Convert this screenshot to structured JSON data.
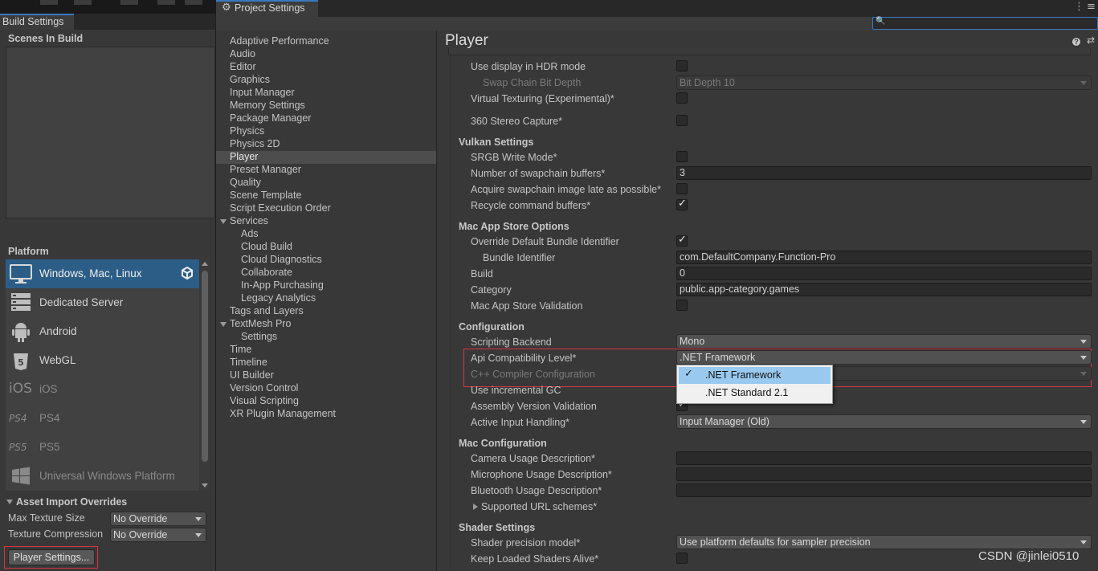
{
  "build_settings": {
    "tab_title": "Build Settings",
    "scenes_header": "Scenes In Build",
    "platform_header": "Platform",
    "platforms": [
      {
        "label": "Windows, Mac, Linux",
        "icon": "monitor-icon",
        "selected": true
      },
      {
        "label": "Dedicated Server",
        "icon": "server-icon"
      },
      {
        "label": "Android",
        "icon": "android-icon"
      },
      {
        "label": "WebGL",
        "icon": "html5-icon",
        "icon_text": "HTML 5"
      },
      {
        "label": "iOS",
        "icon": "ios-icon",
        "icon_text": "iOS",
        "disabled": true
      },
      {
        "label": "PS4",
        "icon": "ps4-icon",
        "icon_text": "PS4",
        "disabled": true
      },
      {
        "label": "PS5",
        "icon": "ps5-icon",
        "icon_text": "PS5",
        "disabled": true
      },
      {
        "label": "Universal Windows Platform",
        "icon": "windows-icon",
        "disabled": true
      }
    ],
    "asset_import_header": "Asset Import Overrides",
    "max_texture_label": "Max Texture Size",
    "max_texture_value": "No Override",
    "texture_compression_label": "Texture Compression",
    "texture_compression_value": "No Override",
    "player_settings_button": "Player Settings..."
  },
  "project_settings": {
    "tab_title": "Project Settings",
    "categories": [
      {
        "label": "Adaptive Performance"
      },
      {
        "label": "Audio"
      },
      {
        "label": "Editor"
      },
      {
        "label": "Graphics"
      },
      {
        "label": "Input Manager"
      },
      {
        "label": "Memory Settings"
      },
      {
        "label": "Package Manager"
      },
      {
        "label": "Physics"
      },
      {
        "label": "Physics 2D"
      },
      {
        "label": "Player",
        "selected": true
      },
      {
        "label": "Preset Manager"
      },
      {
        "label": "Quality"
      },
      {
        "label": "Scene Template"
      },
      {
        "label": "Script Execution Order"
      },
      {
        "label": "Services",
        "foldout": true
      },
      {
        "label": "Ads",
        "child": true
      },
      {
        "label": "Cloud Build",
        "child": true
      },
      {
        "label": "Cloud Diagnostics",
        "child": true
      },
      {
        "label": "Collaborate",
        "child": true
      },
      {
        "label": "In-App Purchasing",
        "child": true
      },
      {
        "label": "Legacy Analytics",
        "child": true
      },
      {
        "label": "Tags and Layers"
      },
      {
        "label": "TextMesh Pro",
        "foldout": true
      },
      {
        "label": "Settings",
        "child": true
      },
      {
        "label": "Time"
      },
      {
        "label": "Timeline"
      },
      {
        "label": "UI Builder"
      },
      {
        "label": "Version Control"
      },
      {
        "label": "Visual Scripting"
      },
      {
        "label": "XR Plugin Management"
      }
    ],
    "panel_title": "Player",
    "rows": {
      "hdr_mode": "Use display in HDR mode",
      "swap_chain": "Swap Chain Bit Depth",
      "swap_chain_value": "Bit Depth 10",
      "virtual_texturing": "Virtual Texturing (Experimental)*",
      "stereo_capture": "360 Stereo Capture*",
      "vulkan_header": "Vulkan Settings",
      "srgb_write": "SRGB Write Mode*",
      "swapchain_buffers": "Number of swapchain buffers*",
      "swapchain_buffers_value": "3",
      "acquire_late": "Acquire swapchain image late as possible*",
      "recycle_buffers": "Recycle command buffers*",
      "mac_store_header": "Mac App Store Options",
      "override_bundle": "Override Default Bundle Identifier",
      "bundle_id": "Bundle Identifier",
      "bundle_id_value": "com.DefaultCompany.Function-Pro",
      "build": "Build",
      "build_value": "0",
      "category": "Category",
      "category_value": "public.app-category.games",
      "store_validation": "Mac App Store Validation",
      "config_header": "Configuration",
      "scripting_backend": "Scripting Backend",
      "scripting_backend_value": "Mono",
      "api_level": "Api Compatibility Level*",
      "api_level_value": ".NET Framework",
      "cpp_config": "C++ Compiler Configuration",
      "incremental_gc": "Use incremental GC",
      "assembly_validation": "Assembly Version Validation",
      "input_handling": "Active Input Handling*",
      "input_handling_value": "Input Manager (Old)",
      "mac_config_header": "Mac Configuration",
      "camera_usage": "Camera Usage Description*",
      "mic_usage": "Microphone Usage Description*",
      "bt_usage": "Bluetooth Usage Description*",
      "url_schemes": "Supported URL schemes*",
      "shader_header": "Shader Settings",
      "shader_precision": "Shader precision model*",
      "shader_precision_value": "Use platform defaults for sampler precision",
      "keep_shaders": "Keep Loaded Shaders Alive*"
    },
    "popup_options": [
      {
        "label": ".NET Framework",
        "selected": true
      },
      {
        "label": ".NET Standard 2.1"
      }
    ]
  },
  "watermark": "CSDN @jinlei0510",
  "colors": {
    "selection_blue": "#2c5d87",
    "popup_highlight": "#99c9ef",
    "annotation_red": "#d9363e"
  }
}
